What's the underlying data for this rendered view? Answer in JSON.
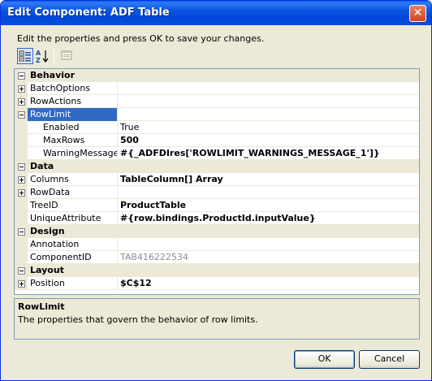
{
  "window": {
    "title": "Edit Component: ADF Table",
    "close_glyph": "✕"
  },
  "instructions": "Edit the properties and press OK to save your changes.",
  "toolbar": {
    "categorized_icon": "categorized-icon",
    "alphabetical_icon": "alphabetical-sort-icon",
    "property_pages_icon": "property-pages-icon",
    "az_glyph": "AZ"
  },
  "grid": {
    "rows": [
      {
        "kind": "category",
        "name": "Behavior"
      },
      {
        "kind": "prop",
        "name": "BatchOptions",
        "value": "",
        "expander": "plus"
      },
      {
        "kind": "prop",
        "name": "RowActions",
        "value": "",
        "expander": "plus"
      },
      {
        "kind": "prop",
        "name": "RowLimit",
        "value": "",
        "expander": "minus",
        "selected": true
      },
      {
        "kind": "sub",
        "name": "Enabled",
        "value": "True"
      },
      {
        "kind": "sub",
        "name": "MaxRows",
        "value": "500",
        "bold": true
      },
      {
        "kind": "sub",
        "name": "WarningMessage",
        "value": "#{_ADFDIres['ROWLIMIT_WARNINGS_MESSAGE_1']}",
        "bold": true
      },
      {
        "kind": "category",
        "name": "Data"
      },
      {
        "kind": "prop",
        "name": "Columns",
        "value": "TableColumn[] Array",
        "expander": "plus",
        "bold": true
      },
      {
        "kind": "prop",
        "name": "RowData",
        "value": "",
        "expander": "plus"
      },
      {
        "kind": "prop",
        "name": "TreeID",
        "value": "ProductTable",
        "bold": true
      },
      {
        "kind": "prop",
        "name": "UniqueAttribute",
        "value": "#{row.bindings.ProductId.inputValue}",
        "bold": true
      },
      {
        "kind": "category",
        "name": "Design"
      },
      {
        "kind": "prop",
        "name": "Annotation",
        "value": ""
      },
      {
        "kind": "prop",
        "name": "ComponentID",
        "value": "TAB416222534",
        "gray": true
      },
      {
        "kind": "category",
        "name": "Layout"
      },
      {
        "kind": "prop",
        "name": "Position",
        "value": "$C$12",
        "expander": "plus",
        "bold": true
      }
    ]
  },
  "description": {
    "title": "RowLimit",
    "text": "The properties that govern the behavior of row limits."
  },
  "buttons": {
    "ok": "OK",
    "cancel": "Cancel"
  },
  "colors": {
    "title_bar": "#0054e3",
    "selection": "#316ac5",
    "window_face": "#ece9d8"
  }
}
